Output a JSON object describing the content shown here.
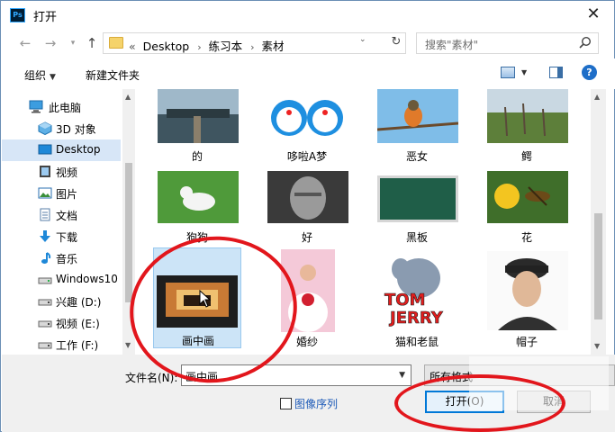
{
  "window": {
    "title": "打开",
    "app_icon_text": "Ps"
  },
  "address_bar": {
    "breadcrumbs": [
      "«",
      "Desktop",
      "练习本",
      "素材"
    ]
  },
  "search": {
    "placeholder": "搜索\"素材\""
  },
  "toolbar": {
    "organize_label": "组织",
    "new_folder_label": "新建文件夹",
    "help_label": "?"
  },
  "sidebar": {
    "items": [
      {
        "label": "此电脑",
        "icon": "computer-icon"
      },
      {
        "label": "3D 对象",
        "icon": "3d-objects-icon"
      },
      {
        "label": "Desktop",
        "icon": "desktop-icon",
        "selected": true
      },
      {
        "label": "视频",
        "icon": "video-icon"
      },
      {
        "label": "图片",
        "icon": "pictures-icon"
      },
      {
        "label": "文档",
        "icon": "documents-icon"
      },
      {
        "label": "下载",
        "icon": "download-icon"
      },
      {
        "label": "音乐",
        "icon": "music-icon"
      },
      {
        "label": "Windows10",
        "icon": "drive-icon"
      },
      {
        "label": "兴趣 (D:)",
        "icon": "drive-icon"
      },
      {
        "label": "视频 (E:)",
        "icon": "drive-icon"
      },
      {
        "label": "工作 (F:)",
        "icon": "drive-icon"
      }
    ]
  },
  "files": [
    {
      "name": "的"
    },
    {
      "name": "哆啦A梦"
    },
    {
      "name": "恶女"
    },
    {
      "name": "鳄"
    },
    {
      "name": "狗狗"
    },
    {
      "name": "好"
    },
    {
      "name": "黑板"
    },
    {
      "name": "花"
    },
    {
      "name": "画中画",
      "selected": true
    },
    {
      "name": "婚纱"
    },
    {
      "name": "猫和老鼠"
    },
    {
      "name": "帽子"
    }
  ],
  "bottom": {
    "filename_label": "文件名(N):",
    "filename_value": "画中画",
    "filetype_value": "所有格式",
    "image_sequence_label": "图像序列",
    "open_label": "打开(O)",
    "cancel_label": "取消"
  },
  "colors": {
    "annotation": "#e2161c",
    "accent": "#0078d7",
    "selection": "#cce4f7"
  }
}
